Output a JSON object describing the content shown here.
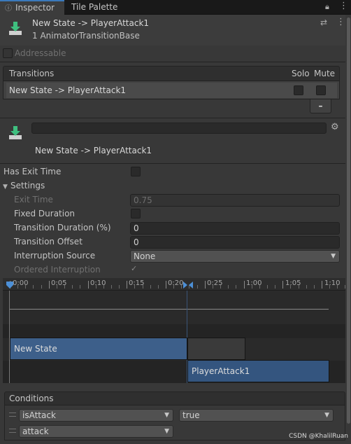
{
  "tabs": [
    {
      "label": "Inspector",
      "icon": "info-icon",
      "active": true
    },
    {
      "label": "Tile Palette",
      "active": false
    }
  ],
  "header": {
    "title": "New State -> PlayerAttack1",
    "subtitle": "1 AnimatorTransitionBase",
    "addressable_label": "Addressable"
  },
  "transitions": {
    "heading": "Transitions",
    "solo_label": "Solo",
    "mute_label": "Mute",
    "rows": [
      {
        "label": "New State -> PlayerAttack1"
      }
    ],
    "remove_label": "–"
  },
  "transition_detail": {
    "name_value": "",
    "caption": "New State -> PlayerAttack1"
  },
  "properties": {
    "has_exit_time_label": "Has Exit Time",
    "has_exit_time": false,
    "settings_label": "Settings",
    "exit_time_label": "Exit Time",
    "exit_time_value": "0.75",
    "fixed_duration_label": "Fixed Duration",
    "fixed_duration": false,
    "transition_duration_label": "Transition Duration (%)",
    "transition_duration_value": "0",
    "transition_offset_label": "Transition Offset",
    "transition_offset_value": "0",
    "interruption_source_label": "Interruption Source",
    "interruption_source_value": "None",
    "ordered_interruption_label": "Ordered Interruption",
    "ordered_interruption": true
  },
  "timeline": {
    "ticks": [
      "0:00",
      "0:05",
      "0:10",
      "0:15",
      "0:20",
      "0:25",
      "1:00",
      "1:05",
      "1:10"
    ],
    "source_state": "New State",
    "dest_state": "PlayerAttack1"
  },
  "conditions": {
    "heading": "Conditions",
    "rows": [
      {
        "parameter": "isAttack",
        "value": "true"
      },
      {
        "parameter": "attack",
        "value": ""
      }
    ]
  },
  "watermark": "CSDN @KhalilRuan",
  "colors": {
    "accent": "#3a79bb",
    "state_bar": "#3d5f8a",
    "dest_bar": "#34557f"
  }
}
